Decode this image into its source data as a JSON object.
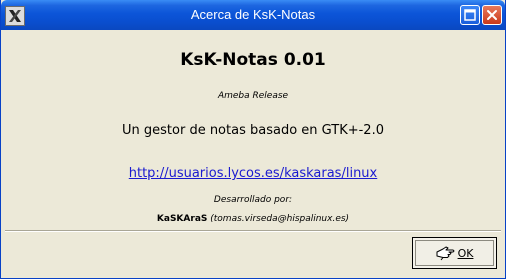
{
  "window": {
    "title": "Acerca de KsK-Notas",
    "icon": "x-logo-icon",
    "controls": {
      "maximize": "maximize-icon",
      "close": "close-icon"
    }
  },
  "about": {
    "app_name": "KsK-Notas 0.01",
    "release": "Ameba Release",
    "description": "Un gestor de notas basado en GTK+-2.0",
    "url": "http://usuarios.lycos.es/kaskaras/linux",
    "developed_by_label": "Desarrollado por:",
    "developer_name": "KaSKAraS",
    "developer_email": "(tomas.virseda@hispalinux.es)"
  },
  "buttons": {
    "ok_label": "OK",
    "ok_icon": "ok-hand-icon"
  },
  "colors": {
    "titlebar": "#0a4fd0",
    "close_button": "#c9391a",
    "link": "#1a1ad0",
    "background": "#ece9d8"
  }
}
